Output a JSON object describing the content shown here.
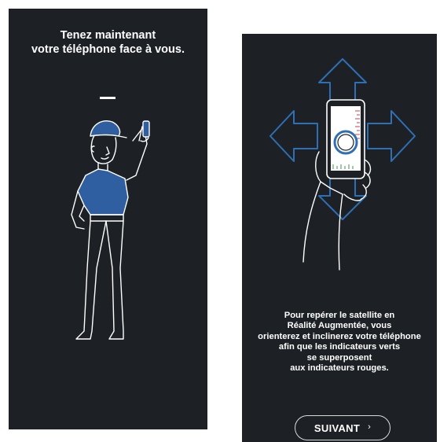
{
  "left_screen": {
    "instruction": "Tenez maintenant\nvotre téléphone face à vous."
  },
  "right_screen": {
    "instruction": "Pour repérer le satellite en\nRéalité Augmentée, vous\norienterez et inclinerez votre téléphone\nafin que les indicateurs verts\nse superposent\naux indicateurs rouges.",
    "next_button": {
      "label": "SUIVANT",
      "icon": "chevron-right-icon",
      "glyph": "›"
    }
  },
  "colors": {
    "background": "#1d2126",
    "shirt_blue": "#2f5fa0",
    "arrow_blue": "#2f6fb3",
    "line_white": "#ffffff"
  }
}
